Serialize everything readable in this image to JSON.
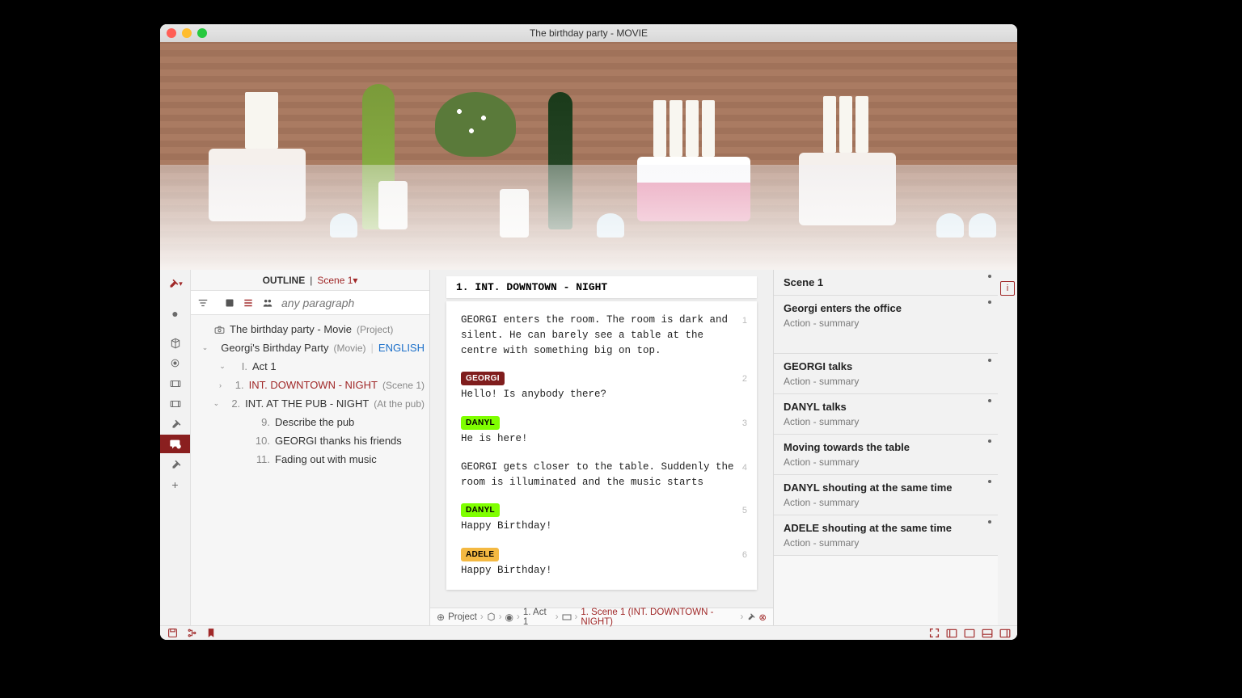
{
  "window_title": "The birthday party - MOVIE",
  "outline": {
    "header_label": "OUTLINE",
    "header_scene": "Scene 1",
    "search_placeholder": "any paragraph",
    "rail_icon_label": "⤳"
  },
  "tree": {
    "project_title": "The birthday party - Movie",
    "project_meta": "(Project)",
    "subtitle": "Georgi's Birthday Party",
    "subtitle_meta": "(Movie)",
    "language": "ENGLISH",
    "act_num": "I.",
    "act_label": "Act 1",
    "scene1_num": "1.",
    "scene1_label": "INT.  DOWNTOWN - NIGHT",
    "scene1_meta": "(Scene 1)",
    "scene2_num": "2.",
    "scene2_label": "INT.  AT THE PUB - NIGHT",
    "scene2_meta": "(At the pub)",
    "item9_num": "9.",
    "item9_label": "Describe the pub",
    "item10_num": "10.",
    "item10_label": "GEORGI thanks his friends",
    "item11_num": "11.",
    "item11_label": "Fading out with music"
  },
  "script": {
    "heading": "1.  INT. DOWNTOWN - NIGHT",
    "p1": "GEORGI enters the room. The room is dark and silent. He can barely see a table at the centre with something big on top.",
    "p1_num": "1",
    "c1": "GEORGI",
    "d1": "Hello! Is anybody there?",
    "d1_num": "2",
    "c2": "DANYL",
    "d2": "He is here!",
    "d2_num": "3",
    "p2": "GEORGI gets closer to the table. Suddenly the room is illuminated and the music starts",
    "p2_num": "4",
    "c3": "DANYL",
    "d3": "Happy Birthday!",
    "d3_num": "5",
    "c4": "ADELE",
    "d4": "Happy Birthday!",
    "d4_num": "6"
  },
  "breadcrumb": {
    "b0": "Project",
    "b1": "1. Act 1",
    "b2": "1. Scene 1 (INT.  DOWNTOWN - NIGHT)"
  },
  "notes": {
    "n0_title": "Scene 1",
    "n1_title": "Georgi enters the office",
    "n1_sub": "Action - summary",
    "n2_title": "GEORGI talks",
    "n2_sub": "Action - summary",
    "n3_title": "DANYL talks",
    "n3_sub": "Action - summary",
    "n4_title": "Moving towards the table",
    "n4_sub": "Action - summary",
    "n5_title": "DANYL shouting at the same time",
    "n5_sub": "Action - summary",
    "n6_title": "ADELE shouting at the same time",
    "n6_sub": "Action - summary"
  }
}
